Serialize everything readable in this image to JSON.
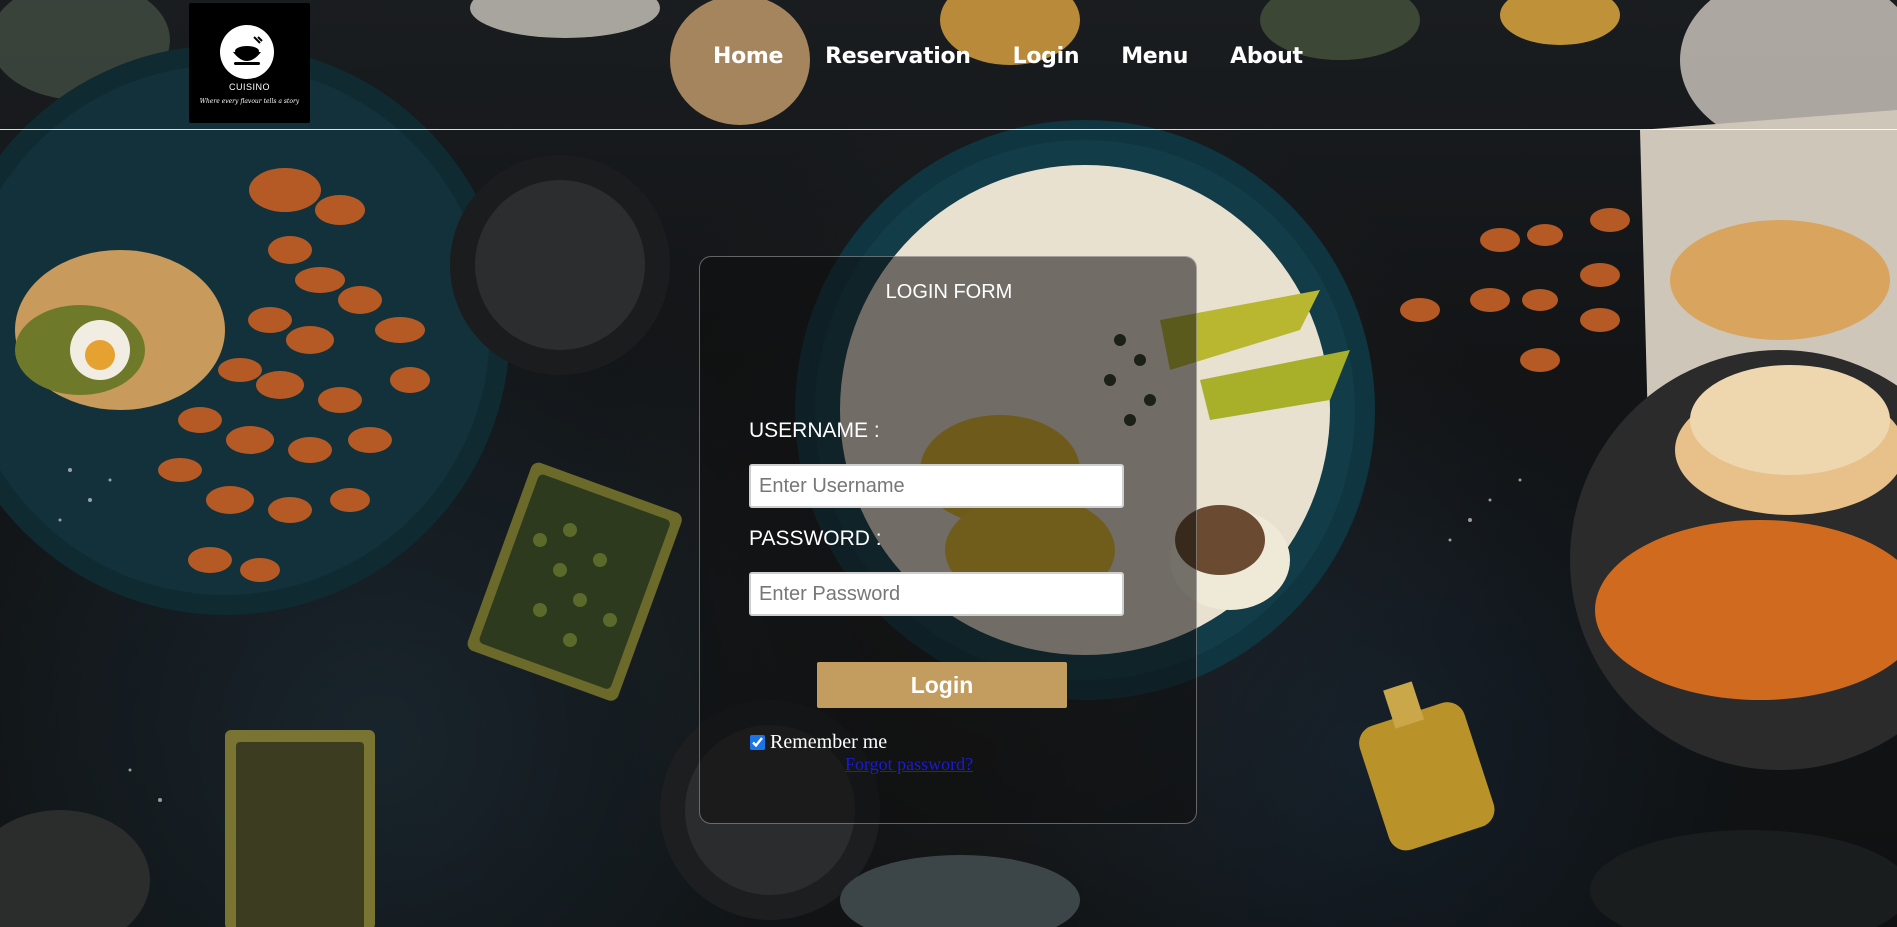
{
  "logo": {
    "name": "CUISINO",
    "tagline": "Where every flavour tells a story"
  },
  "nav": {
    "items": [
      {
        "label": "Home"
      },
      {
        "label": "Reservation"
      },
      {
        "label": "Login"
      },
      {
        "label": "Menu"
      },
      {
        "label": "About"
      }
    ]
  },
  "form": {
    "title": "LOGIN FORM",
    "username_label": "USERNAME :",
    "username_placeholder": "Enter Username",
    "username_value": "",
    "password_label": "PASSWORD :",
    "password_placeholder": "Enter Password",
    "password_value": "",
    "login_label": "Login",
    "remember_label": "Remember me",
    "remember_checked": true,
    "forgot_label": "Forgot password?"
  },
  "colors": {
    "accent_button": "#c39d5f",
    "link": "#1a1adb",
    "panel_background": "rgba(15,15,15,0.55)",
    "header_border": "#ffffff"
  }
}
